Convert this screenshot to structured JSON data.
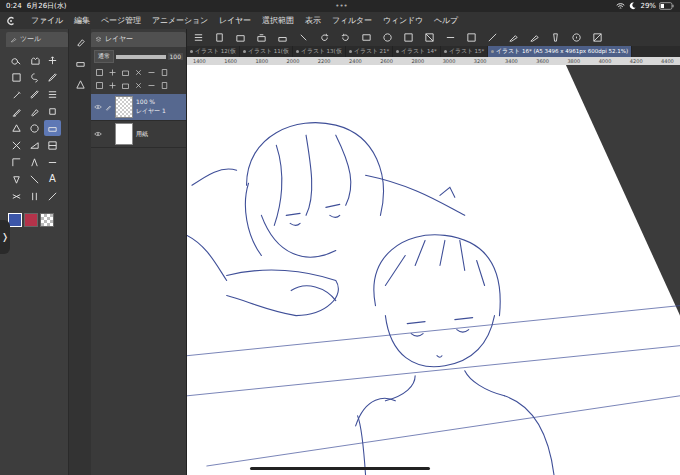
{
  "status_bar": {
    "time": "0:24",
    "date": "6月26日(水)",
    "dots": "•••",
    "battery": "29%"
  },
  "menu": [
    "ファイル",
    "編集",
    "ページ管理",
    "アニメーション",
    "レイヤー",
    "選択範囲",
    "表示",
    "フィルター",
    "ウィンドウ",
    "ヘルプ"
  ],
  "tool_panel": {
    "title": "ツール",
    "tools": [
      {
        "selected": false,
        "glyph": ""
      },
      {
        "selected": false,
        "glyph": ""
      },
      {
        "selected": false,
        "glyph": ""
      },
      {
        "selected": false,
        "glyph": ""
      },
      {
        "selected": false,
        "glyph": ""
      },
      {
        "selected": false,
        "glyph": ""
      },
      {
        "selected": false,
        "glyph": ""
      },
      {
        "selected": false,
        "glyph": ""
      },
      {
        "selected": false,
        "glyph": ""
      },
      {
        "selected": false,
        "glyph": ""
      },
      {
        "selected": false,
        "glyph": ""
      },
      {
        "selected": false,
        "glyph": ""
      },
      {
        "selected": false,
        "glyph": ""
      },
      {
        "selected": false,
        "glyph": ""
      },
      {
        "selected": true,
        "glyph": ""
      },
      {
        "selected": false,
        "glyph": ""
      },
      {
        "selected": false,
        "glyph": ""
      },
      {
        "selected": false,
        "glyph": ""
      },
      {
        "selected": false,
        "glyph": ""
      },
      {
        "selected": false,
        "glyph": ""
      },
      {
        "selected": false,
        "glyph": ""
      },
      {
        "selected": false,
        "glyph": ""
      },
      {
        "selected": false,
        "glyph": ""
      },
      {
        "selected": false,
        "glyph": "A"
      },
      {
        "selected": false,
        "glyph": ""
      },
      {
        "selected": false,
        "glyph": ""
      },
      {
        "selected": false,
        "glyph": ""
      }
    ],
    "colors": [
      {
        "kind": "solid",
        "color": "#3c56a8",
        "selected": true
      },
      {
        "kind": "solid",
        "color": "#b3334a",
        "selected": false
      },
      {
        "kind": "transparent",
        "color": "#ffffff",
        "selected": false
      }
    ]
  },
  "layer_panel": {
    "title": "レイヤー",
    "blend_mode": "通常",
    "opacity": "100",
    "layers": [
      {
        "name": "レイヤー 1",
        "opacity": "100 %",
        "visible": true,
        "selected": true,
        "kind": "raster"
      },
      {
        "name": "用紙",
        "opacity": "",
        "visible": true,
        "selected": false,
        "kind": "paper"
      }
    ]
  },
  "tabs": [
    {
      "label": "イラスト 12(仮",
      "selected": false
    },
    {
      "label": "イラスト 11(仮",
      "selected": false
    },
    {
      "label": "イラスト 13(仮",
      "selected": false
    },
    {
      "label": "イラスト 21*",
      "selected": false
    },
    {
      "label": "イラスト 14*",
      "selected": false
    },
    {
      "label": "イラスト 15*",
      "selected": false
    },
    {
      "label": "イラスト 16* (A5 3496 x 4961px 600dpi 52.1%)",
      "selected": true
    }
  ],
  "ruler": [
    "1400",
    "1600",
    "1800",
    "2000",
    "2200",
    "2400",
    "2600",
    "2800",
    "3000",
    "3200",
    "3400",
    "3600",
    "3800",
    "4000",
    "4200",
    "4400"
  ],
  "sidebar_handle": "❭"
}
